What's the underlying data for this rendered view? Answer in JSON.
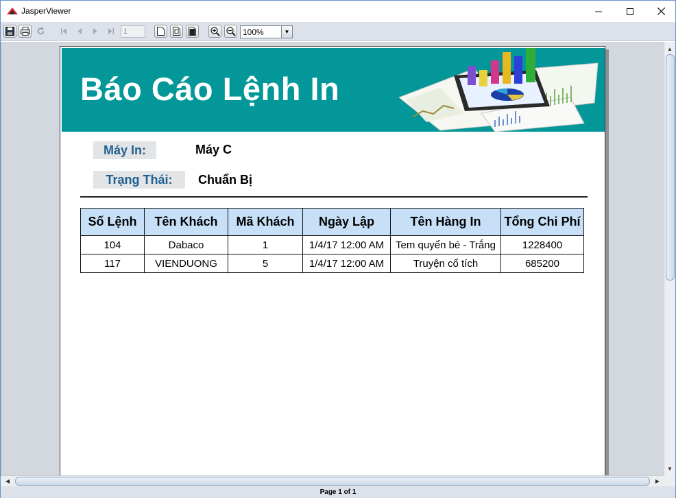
{
  "window": {
    "title": "JasperViewer"
  },
  "toolbar": {
    "page_number": "1",
    "zoom": "100%"
  },
  "report": {
    "title": "Báo Cáo Lệnh In",
    "printer_label": "Máy In:",
    "printer_value": "Máy C",
    "status_label": "Trạng Thái:",
    "status_value": "Chuẩn Bị",
    "columns": [
      "Số Lệnh",
      "Tên Khách",
      "Mã Khách",
      "Ngày Lập",
      "Tên Hàng In",
      "Tổng Chi Phí"
    ],
    "rows": [
      [
        "104",
        "Dabaco",
        "1",
        "1/4/17 12:00 AM",
        "Tem quyển bé - Trắng",
        "1228400"
      ],
      [
        "117",
        "VIENDUONG",
        "5",
        "1/4/17 12:00 AM",
        "Truyện cổ tích",
        "685200"
      ]
    ]
  },
  "status": {
    "page_info": "Page 1 of 1"
  },
  "colors": {
    "banner": "#04979a",
    "header_fill": "#c7e0f7",
    "label_text": "#1f5f91"
  }
}
